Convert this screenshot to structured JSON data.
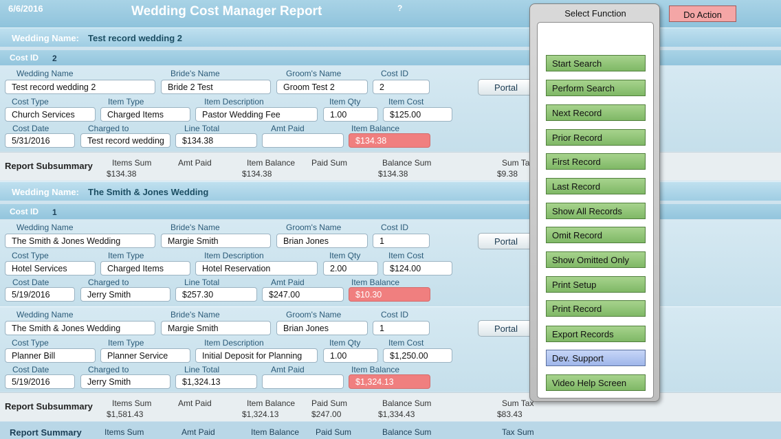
{
  "header": {
    "date": "6/6/2016",
    "title": "Wedding Cost Manager Report",
    "help": "?"
  },
  "labels": {
    "wedding_name_bar": "Wedding Name:",
    "cost_id_bar": "Cost ID",
    "wedding_name": "Wedding Name",
    "brides_name": "Bride's Name",
    "grooms_name": "Groom's Name",
    "cost_id": "Cost ID",
    "cost_type": "Cost Type",
    "item_type": "Item Type",
    "item_description": "Item Description",
    "item_qty": "Item Qty",
    "item_cost": "Item Cost",
    "cost_date": "Cost Date",
    "charged_to": "Charged to",
    "line_total": "Line Total",
    "amt_paid": "Amt Paid",
    "item_balance": "Item Balance",
    "portal": "Portal"
  },
  "groups": [
    {
      "wedding_name": "Test record wedding 2",
      "cost_id": "2",
      "records": [
        {
          "wedding_name": "Test record wedding 2",
          "brides_name": "Bride 2 Test",
          "grooms_name": "Groom Test 2",
          "cost_id": "2",
          "cost_type": "Church Services",
          "item_type": "Charged Items",
          "item_description": "Pastor Wedding Fee",
          "item_qty": "1.00",
          "item_cost": "$125.00",
          "cost_date": "5/31/2016",
          "charged_to": "Test record wedding",
          "line_total": "$134.38",
          "amt_paid": "",
          "item_balance": "$134.38"
        }
      ],
      "subsummary": {
        "title": "Report Subsummary",
        "labels": [
          "Items Sum",
          "Amt Paid",
          "Item Balance",
          "Paid Sum",
          "Balance Sum",
          "Sum Tax"
        ],
        "values": [
          "$134.38",
          "",
          "$134.38",
          "",
          "$134.38",
          "$9.38"
        ]
      }
    },
    {
      "wedding_name": "The Smith & Jones Wedding",
      "cost_id": "1",
      "records": [
        {
          "wedding_name": "The Smith & Jones Wedding",
          "brides_name": "Margie Smith",
          "grooms_name": "Brian Jones",
          "cost_id": "1",
          "cost_type": "Hotel Services",
          "item_type": "Charged Items",
          "item_description": "Hotel Reservation",
          "item_qty": "2.00",
          "item_cost": "$124.00",
          "cost_date": "5/19/2016",
          "charged_to": "Jerry Smith",
          "line_total": "$257.30",
          "amt_paid": "$247.00",
          "item_balance": "$10.30"
        },
        {
          "wedding_name": "The Smith & Jones Wedding",
          "brides_name": "Margie Smith",
          "grooms_name": "Brian Jones",
          "cost_id": "1",
          "cost_type": "Planner Bill",
          "item_type": "Planner Service",
          "item_description": "Initial Deposit for Planning",
          "item_qty": "1.00",
          "item_cost": "$1,250.00",
          "cost_date": "5/19/2016",
          "charged_to": "Jerry Smith",
          "line_total": "$1,324.13",
          "amt_paid": "",
          "item_balance": "$1,324.13"
        }
      ],
      "subsummary": {
        "title": "Report Subsummary",
        "labels": [
          "Items Sum",
          "Amt Paid",
          "Item Balance",
          "Paid Sum",
          "Balance Sum",
          "Sum Tax"
        ],
        "values": [
          "$1,581.43",
          "",
          "$1,324.13",
          "$247.00",
          "$1,334.43",
          "$83.43"
        ]
      }
    }
  ],
  "summary": {
    "title": "Report Summary",
    "labels": [
      "Items Sum",
      "Amt Paid",
      "Item Balance",
      "Paid Sum",
      "Balance Sum",
      "Tax Sum"
    ]
  },
  "popup": {
    "title": "Select Function",
    "buttons": [
      "Start Search",
      "Perform Search",
      "Next Record",
      "Prior Record",
      "First Record",
      "Last Record",
      "Show All Records",
      "Omit Record",
      "Show Omitted Only",
      "Print Setup",
      "Print Record",
      "Export Records",
      "Dev. Support",
      "Video Help Screen"
    ],
    "do_action": "Do Action"
  },
  "colors": {
    "balance_red": "#f07f7f",
    "button_green": "#8fc476",
    "button_blue": "#b3c6f0"
  }
}
